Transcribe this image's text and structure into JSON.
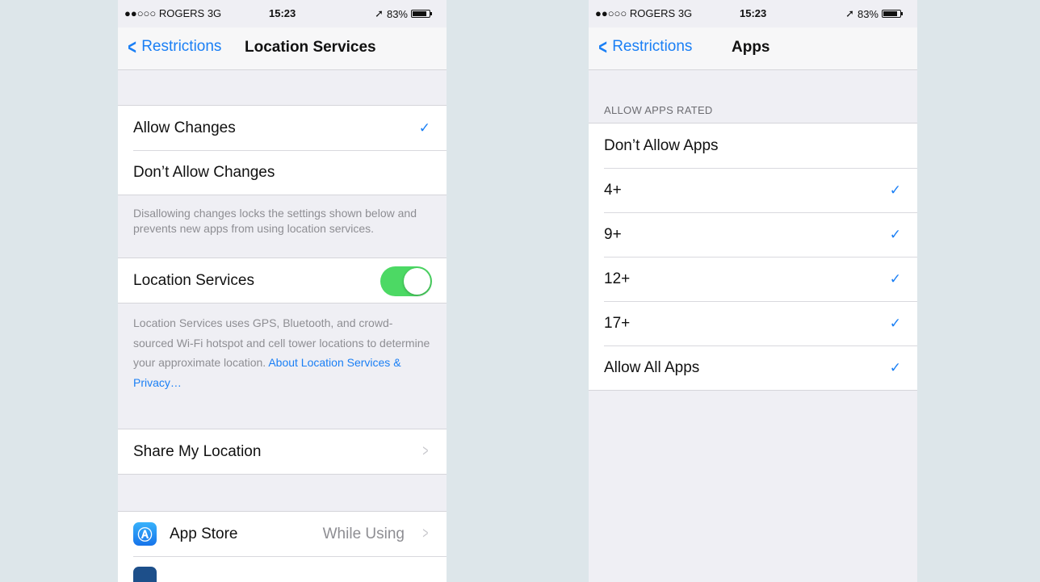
{
  "left": {
    "status": {
      "carrier": "●●○○○ ROGERS  3G",
      "time": "15:23",
      "battery": "83%",
      "battery_level": 0.83
    },
    "nav": {
      "back_label": "Restrictions",
      "title": "Location Services"
    },
    "allow_changes": {
      "label": "Allow Changes",
      "checked": true
    },
    "dont_allow_changes": {
      "label": "Don’t Allow Changes"
    },
    "changes_footnote": "Disallowing changes locks the settings shown below and prevents new apps from using location services.",
    "location_services": {
      "label": "Location Services",
      "enabled": true
    },
    "ls_footnote": "Location Services uses GPS, Bluetooth, and crowd-sourced Wi-Fi hotspot and cell tower locations to determine your approximate location.",
    "ls_link": "About Location Services & Privacy…",
    "share_my_location": {
      "label": "Share My Location"
    },
    "apps": [
      {
        "name": "App Store",
        "detail": "While Using",
        "icon": "app-store-icon"
      }
    ]
  },
  "right": {
    "status": {
      "carrier": "●●○○○ ROGERS  3G",
      "time": "15:23",
      "battery": "83%",
      "battery_level": 0.83
    },
    "nav": {
      "back_label": "Restrictions",
      "title": "Apps"
    },
    "section_header": "ALLOW APPS RATED",
    "options": [
      {
        "label": "Don’t Allow Apps",
        "checked": false
      },
      {
        "label": "4+",
        "checked": true
      },
      {
        "label": "9+",
        "checked": true
      },
      {
        "label": "12+",
        "checked": true
      },
      {
        "label": "17+",
        "checked": true
      },
      {
        "label": "Allow All Apps",
        "checked": true
      }
    ]
  },
  "colors": {
    "accent": "#1a7ff5",
    "toggle_on": "#4cd964",
    "background": "#efeff4",
    "page_bg": "#dde6ea"
  }
}
